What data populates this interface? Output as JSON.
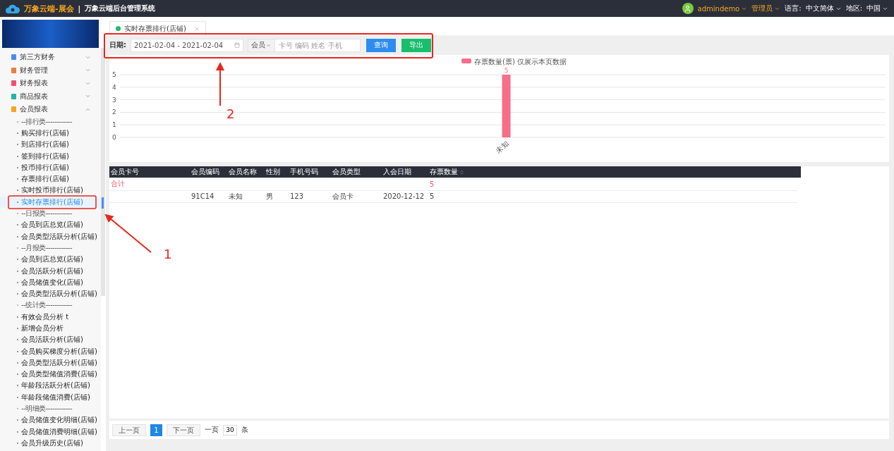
{
  "header": {
    "brand": "万象云端-展会",
    "separator": "|",
    "system_name": "万象云端后台管理系统",
    "user": "admindemo",
    "role": "管理员",
    "language_label": "语言:",
    "language": "中文简体",
    "region_label": "地区:",
    "region": "中国"
  },
  "sidebar": {
    "sections": [
      {
        "label": "第三方财务",
        "color": "#4a8af4",
        "expanded": false
      },
      {
        "label": "财务管理",
        "color": "#f07b3f",
        "expanded": false
      },
      {
        "label": "财务报表",
        "color": "#f0506e",
        "expanded": false
      },
      {
        "label": "商品报表",
        "color": "#1fb5a8",
        "expanded": false
      },
      {
        "label": "会员报表",
        "color": "#f5a623",
        "expanded": true
      }
    ],
    "items": [
      {
        "kind": "group",
        "label": "--排行类------------",
        "selected": false
      },
      {
        "kind": "link",
        "label": "购买排行(店铺)",
        "selected": false
      },
      {
        "kind": "link",
        "label": "到店排行(店铺)",
        "selected": false
      },
      {
        "kind": "link",
        "label": "签到排行(店铺)",
        "selected": false
      },
      {
        "kind": "link",
        "label": "投币排行(店铺)",
        "selected": false
      },
      {
        "kind": "link",
        "label": "存票排行(店铺)",
        "selected": false
      },
      {
        "kind": "link",
        "label": "实时投币排行(店铺)",
        "selected": false
      },
      {
        "kind": "link",
        "label": "实时存票排行(店铺)",
        "selected": true
      },
      {
        "kind": "group",
        "label": "--日报类------------",
        "selected": false
      },
      {
        "kind": "link",
        "label": "会员到店总览(店铺)",
        "selected": false
      },
      {
        "kind": "link",
        "label": "会员类型活跃分析(店铺)",
        "selected": false
      },
      {
        "kind": "group",
        "label": "--月报类------------",
        "selected": false
      },
      {
        "kind": "link",
        "label": "会员到店总览(店铺)",
        "selected": false
      },
      {
        "kind": "link",
        "label": "会员活跃分析(店铺)",
        "selected": false
      },
      {
        "kind": "link",
        "label": "会员储值变化(店铺)",
        "selected": false
      },
      {
        "kind": "link",
        "label": "会员类型活跃分析(店铺)",
        "selected": false
      },
      {
        "kind": "group",
        "label": "--统计类------------",
        "selected": false
      },
      {
        "kind": "link",
        "label": "有效会员分析 t",
        "selected": false
      },
      {
        "kind": "link",
        "label": "新增会员分析",
        "selected": false
      },
      {
        "kind": "link",
        "label": "会员活跃分析(店铺)",
        "selected": false
      },
      {
        "kind": "link",
        "label": "会员购买梯度分析(店铺)",
        "selected": false
      },
      {
        "kind": "link",
        "label": "会员类型活跃分析(店铺)",
        "selected": false
      },
      {
        "kind": "link",
        "label": "会员类型储值消费(店铺)",
        "selected": false
      },
      {
        "kind": "link",
        "label": "年龄段活跃分析(店铺)",
        "selected": false
      },
      {
        "kind": "link",
        "label": "年龄段储值消费(店铺)",
        "selected": false
      },
      {
        "kind": "group",
        "label": "--明细类------------",
        "selected": false
      },
      {
        "kind": "link",
        "label": "会员储值变化明细(店铺)",
        "selected": false
      },
      {
        "kind": "link",
        "label": "会员储值消费明细(店铺)",
        "selected": false
      },
      {
        "kind": "link",
        "label": "会员升级历史(店铺)",
        "selected": false
      }
    ]
  },
  "tabs": [
    {
      "label": "实时存票排行(店铺)",
      "selected": true
    }
  ],
  "filter": {
    "date_label": "日期:",
    "date_value": "2021-02-04 - 2021-02-04",
    "member_select": "会员",
    "search_placeholder": "卡号 编码 姓名 手机",
    "query_button": "查询",
    "export_button": "导出"
  },
  "chart": {
    "chart_data": {
      "type": "bar",
      "categories": [
        "未知"
      ],
      "series": [
        {
          "name": "存票数量(票) 仅展示本页数据",
          "color": "#f46f8a",
          "values": [
            5
          ]
        }
      ],
      "ylim": [
        0,
        5
      ],
      "grid": true,
      "yticks": [
        0,
        1,
        2,
        3,
        4,
        5
      ],
      "data_labels": true
    }
  },
  "table": {
    "columns": [
      "会员卡号",
      "会员编码",
      "会员名称",
      "性别",
      "手机号码",
      "会员类型",
      "入会日期",
      "存票数量"
    ],
    "total_row": {
      "label": "合计",
      "value": "5"
    },
    "rows": [
      [
        "",
        "91C14",
        "未知",
        "男",
        "123",
        "会员卡",
        "2020-12-12",
        "5"
      ]
    ]
  },
  "pagination": {
    "prev": "上一页",
    "pages": [
      {
        "label": "1",
        "selected": true
      }
    ],
    "next": "下一页",
    "per_page_label": "一页",
    "per_page": "30",
    "unit": "条"
  },
  "annotations": [
    {
      "number": "1"
    },
    {
      "number": "2"
    }
  ]
}
